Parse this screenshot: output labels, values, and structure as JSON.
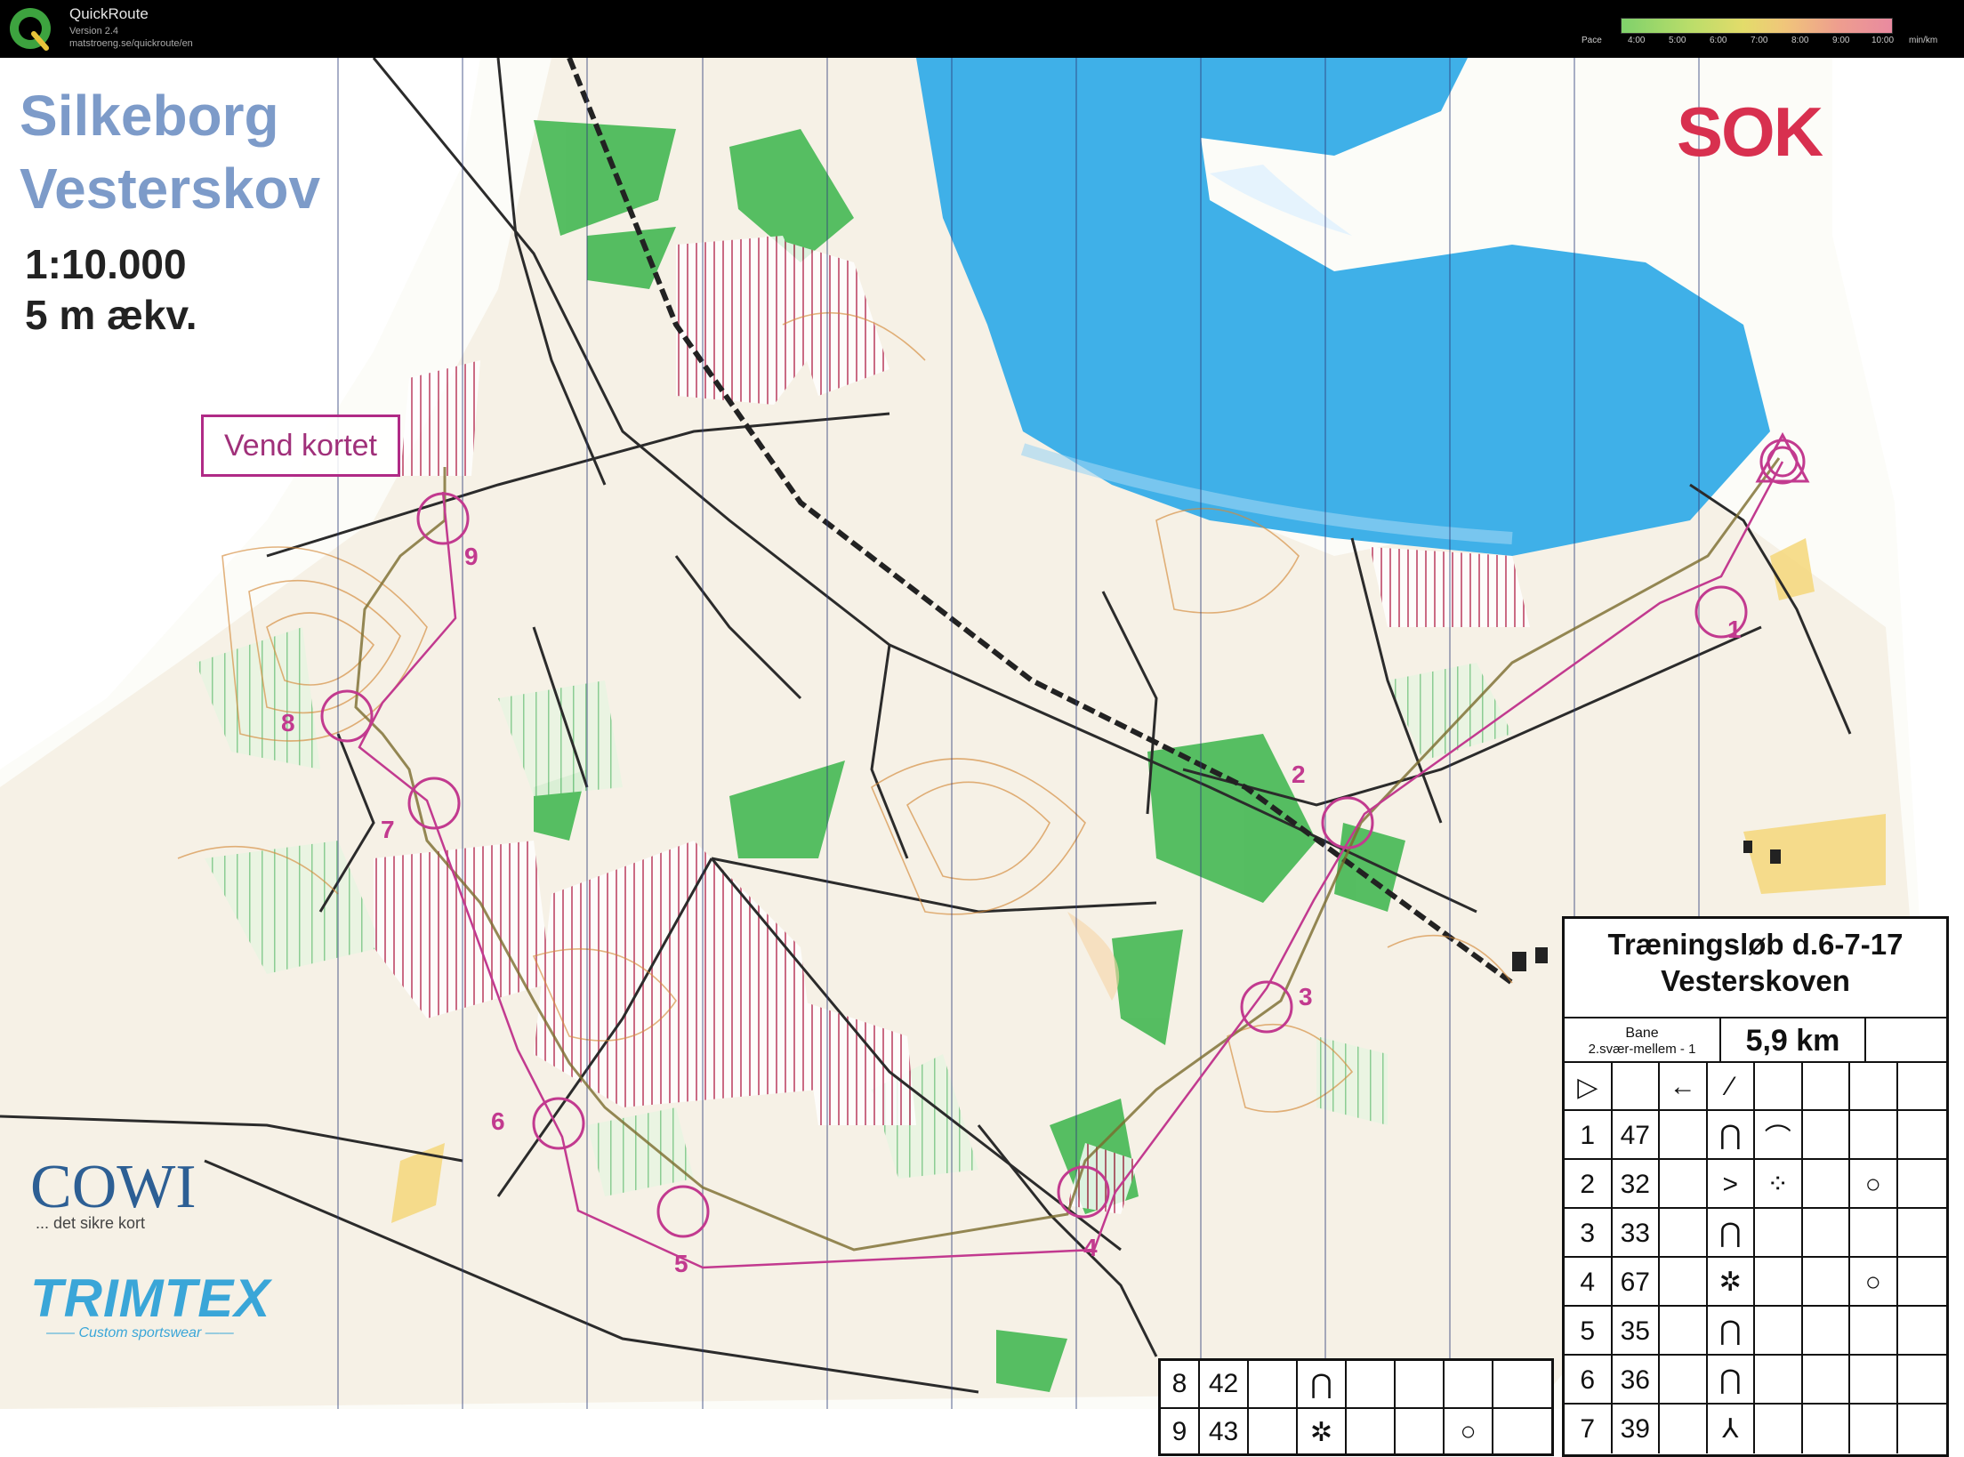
{
  "app": {
    "title": "QuickRoute",
    "version": "Version 2.4",
    "url": "matstroeng.se/quickroute/en",
    "logo_icon": "quickroute-q-icon"
  },
  "pace_legend": {
    "label": "Pace",
    "ticks": [
      "4:00",
      "5:00",
      "6:00",
      "7:00",
      "8:00",
      "9:00",
      "10:00"
    ],
    "unit": "min/km",
    "colors": [
      "#7fd16b",
      "#e3dc6a",
      "#e98aa0"
    ]
  },
  "map": {
    "title_line1": "Silkeborg",
    "title_line2": "Vesterskov",
    "scale": "1:10.000",
    "equidistance": "5 m ækv.",
    "vend_label": "Vend kortet",
    "club_logo": "SOK",
    "sponsor1": "COWI",
    "sponsor1_tagline": "... det sikre kort",
    "sponsor2": "TRIMTEX",
    "sponsor2_tagline": "—— Custom sportswear ——",
    "course_color": "#c23a8f",
    "water_color": "#3fb0e8",
    "forest_color": "#39b54a",
    "controls": [
      {
        "label": "1"
      },
      {
        "label": "2"
      },
      {
        "label": "3"
      },
      {
        "label": "4"
      },
      {
        "label": "5"
      },
      {
        "label": "6"
      },
      {
        "label": "7"
      },
      {
        "label": "8"
      },
      {
        "label": "9"
      }
    ]
  },
  "description": {
    "title1": "Træningsløb d.6-7-17",
    "title2": "Vesterskoven",
    "course_label": "Bane",
    "course_name": "2.svær-mellem - 1",
    "length": "5,9 km",
    "start_symbol": "▷",
    "start_icons": [
      "←",
      "⁄"
    ],
    "rows": [
      {
        "num": "1",
        "code": "47",
        "feature": "⋂",
        "extra": "⌒",
        "apply": ""
      },
      {
        "num": "2",
        "code": "32",
        "feature": ">",
        "extra": "⁘",
        "apply": "○"
      },
      {
        "num": "3",
        "code": "33",
        "feature": "⋂",
        "extra": "",
        "apply": ""
      },
      {
        "num": "4",
        "code": "67",
        "feature": "✲",
        "extra": "",
        "apply": "○"
      },
      {
        "num": "5",
        "code": "35",
        "feature": "⋂",
        "extra": "",
        "apply": ""
      },
      {
        "num": "6",
        "code": "36",
        "feature": "⋂",
        "extra": "",
        "apply": ""
      },
      {
        "num": "7",
        "code": "39",
        "feature": "⅄",
        "extra": "",
        "apply": ""
      }
    ],
    "rows_extra": [
      {
        "num": "8",
        "code": "42",
        "feature": "⋂",
        "extra": "",
        "apply": ""
      },
      {
        "num": "9",
        "code": "43",
        "feature": "✲",
        "extra": "",
        "apply": "○"
      }
    ]
  }
}
